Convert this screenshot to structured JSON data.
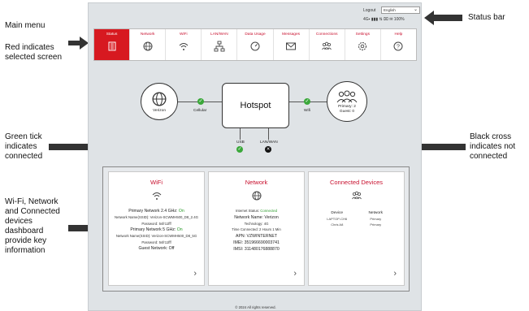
{
  "annotations": {
    "main_menu": "Main menu",
    "red_selected": "Red indicates selected screen",
    "status_bar": "Status bar",
    "green_tick": "Green tick indicates connected",
    "black_cross": "Black cross indicates not connected",
    "dashboard": "Wi-Fi, Network and Connected devices dashboard provide key information"
  },
  "topbar": {
    "logout": "Logout",
    "language": "English",
    "status_text": "4G▪ ▮▮▮ ⇅ ⌧ ✉ 100%"
  },
  "menu": {
    "items": [
      {
        "label": "Status",
        "icon": "status-icon"
      },
      {
        "label": "Network",
        "icon": "globe-icon"
      },
      {
        "label": "WiFi",
        "icon": "wifi-icon"
      },
      {
        "label": "LAN/WAN",
        "icon": "lan-icon"
      },
      {
        "label": "Data Usage",
        "icon": "gauge-icon"
      },
      {
        "label": "Messages",
        "icon": "envelope-icon"
      },
      {
        "label": "Connections",
        "icon": "users-icon"
      },
      {
        "label": "Settings",
        "icon": "gear-icon"
      },
      {
        "label": "Help",
        "icon": "help-icon"
      }
    ],
    "active": "Status"
  },
  "diagram": {
    "carrier": "Verizon",
    "cellular": "Cellular",
    "hotspot": "Hotspot",
    "wifi": "Wifi",
    "primary": "Primary: 2",
    "guest": "Guest: 0",
    "usb": "USB",
    "lanwan": "LAN/WAN",
    "usb_connected": true,
    "lanwan_connected": false,
    "colors": {
      "connected": "#3aa83a",
      "not_connected": "#111111"
    }
  },
  "wifi_card": {
    "title": "WiFi",
    "primary_24_label": "Primary Network 2.4 GHz:",
    "primary_24_state": "On",
    "primary_24_name": "Network Name(SSID): Verizon-SCWMH500_D8_2.4G",
    "primary_24_pw": "Password: 5sfr11fff",
    "primary_5_label": "Primary Network 5 GHz:",
    "primary_5_state": "On",
    "primary_5_name": "Network Name(SSID): Verizon-SCWMH500_D8_5G",
    "primary_5_pw": "Password: 5sfr11fff",
    "guest": "Guest Network: Off"
  },
  "network_card": {
    "title": "Network",
    "status_label": "Internet Status:",
    "status_value": "Connected",
    "network_name": "Network Name: Verizon",
    "technology": "Technology: 4G",
    "time_connected": "Time Connected: 2 Hours 1 Min",
    "apn": "APN: VZWINTERNET",
    "imei": "IMEI: 351966690003741",
    "imsi": "IMSI: 311480176888870"
  },
  "devices_card": {
    "title": "Connected Devices",
    "col_device": "Device",
    "col_network": "Network",
    "rows": [
      {
        "device": "LAPTOP-CH6",
        "network": "Primary"
      },
      {
        "device": "Chris A8",
        "network": "Primary"
      }
    ]
  },
  "footer": "© 2024 All rights reserved.",
  "colors": {
    "brand_red": "#d71920",
    "green": "#3aa83a"
  }
}
